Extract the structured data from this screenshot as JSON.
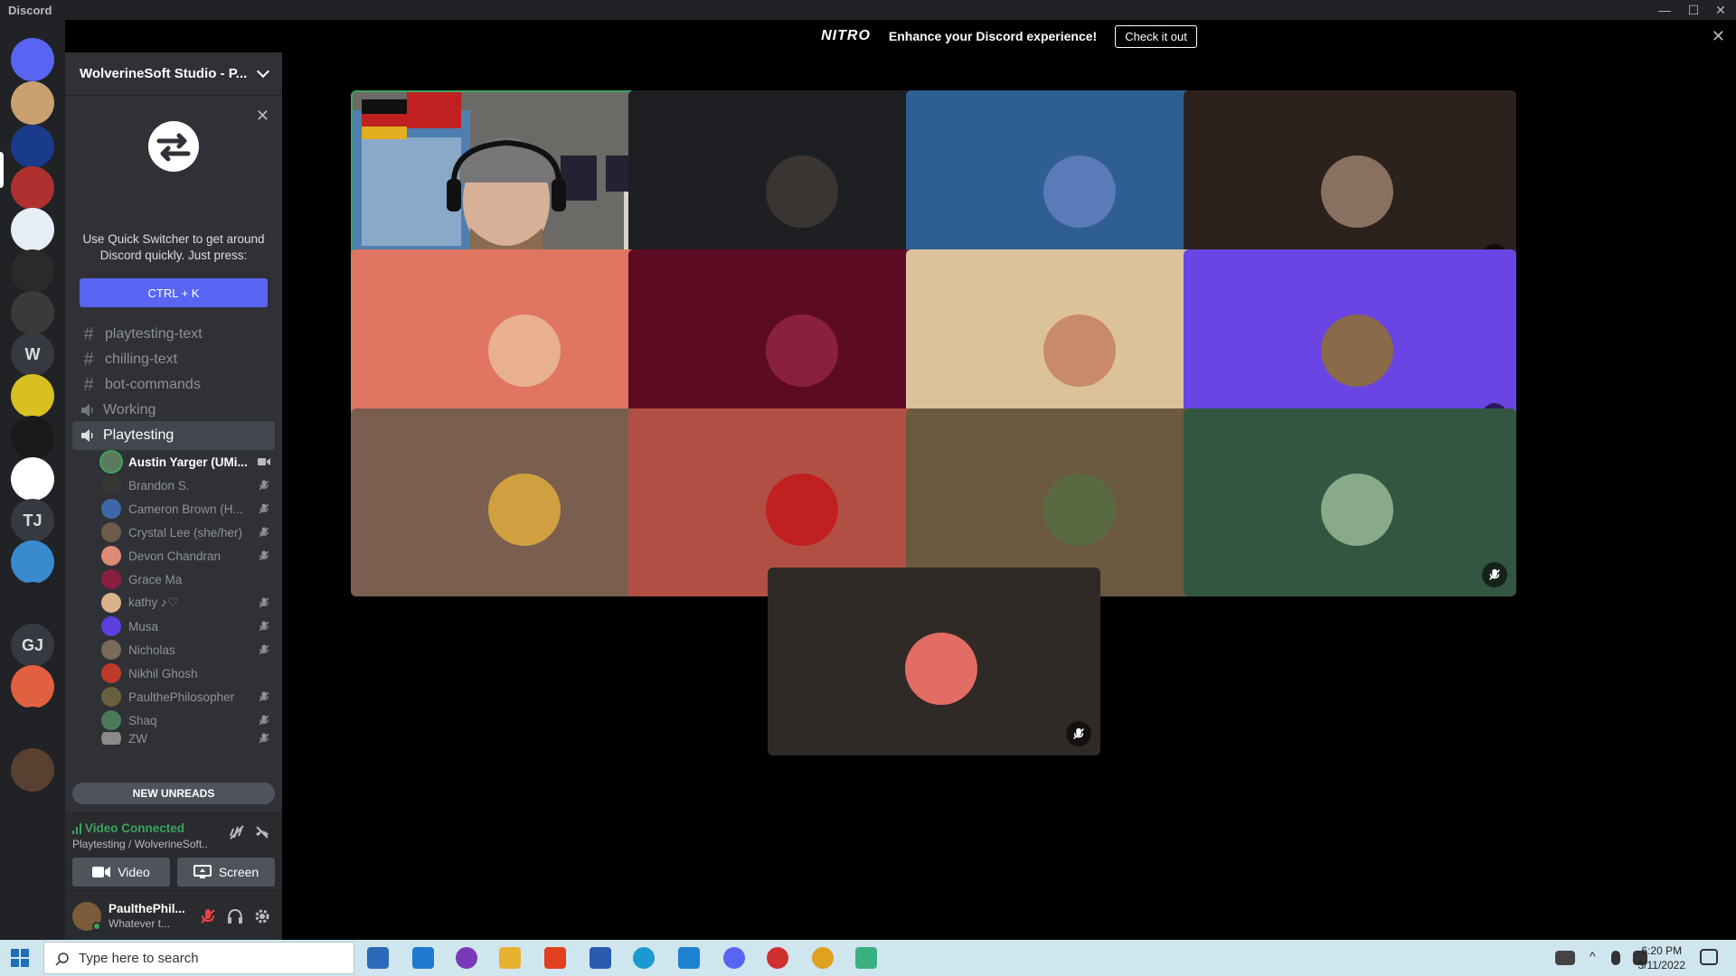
{
  "window": {
    "app_name": "Discord",
    "minimize": "—",
    "maximize": "☐",
    "close": "✕"
  },
  "nitro_banner": {
    "logo": "NITRO",
    "message": "Enhance your Discord experience!",
    "cta": "Check it out",
    "close": "✕"
  },
  "guild": {
    "name": "WolverineSoft Studio - P..."
  },
  "quick_switcher": {
    "text": "Use Quick Switcher to get around Discord quickly. Just press:",
    "shortcut": "CTRL + K",
    "close": "✕"
  },
  "channels": [
    {
      "name": "playtesting-text",
      "type": "text"
    },
    {
      "name": "chilling-text",
      "type": "text"
    },
    {
      "name": "bot-commands",
      "type": "text"
    },
    {
      "name": "Working",
      "type": "voice"
    },
    {
      "name": "Playtesting",
      "type": "voice",
      "active": true
    }
  ],
  "voice_members": [
    {
      "name": "Austin Yarger (UMi...",
      "color": "#5d7a5c",
      "muted": false,
      "video": true
    },
    {
      "name": "Brandon S.",
      "color": "#3a3535",
      "muted": true
    },
    {
      "name": "Cameron Brown (H...",
      "color": "#3f67a8",
      "muted": true
    },
    {
      "name": "Crystal Lee (she/her)",
      "color": "#6e5a4a",
      "muted": true
    },
    {
      "name": "Devon Chandran",
      "color": "#e08a78",
      "muted": true
    },
    {
      "name": "Grace Ma",
      "color": "#8a2040",
      "muted": false
    },
    {
      "name": "kathy ♪♡",
      "color": "#d9b48a",
      "muted": true
    },
    {
      "name": "Musa",
      "color": "#5f3ee0",
      "muted": true
    },
    {
      "name": "Nicholas",
      "color": "#7a6a5a",
      "muted": true
    },
    {
      "name": "Nikhil Ghosh",
      "color": "#c03a2a",
      "muted": false
    },
    {
      "name": "PaulthePhilosopher",
      "color": "#6a6040",
      "muted": true
    },
    {
      "name": "Shaq",
      "color": "#4a7a5a",
      "muted": true
    },
    {
      "name": "ZW",
      "color": "#8a8a8a",
      "muted": true
    }
  ],
  "new_unreads": "NEW UNREADS",
  "rtc": {
    "status": "Video Connected",
    "channel": "Playtesting / WolverineSoft...",
    "video_label": "Video",
    "screen_label": "Screen"
  },
  "user": {
    "name": "PaulthePhil...",
    "status": "Whatever t..."
  },
  "servers": [
    {
      "label": "",
      "color": "#5865f2"
    },
    {
      "label": "",
      "color": "#c9a070"
    },
    {
      "label": "",
      "color": "#1a3a8a"
    },
    {
      "label": "",
      "color": "#b03030"
    },
    {
      "label": "",
      "color": "#e8eef8"
    },
    {
      "label": "",
      "color": "#2a2a2a"
    },
    {
      "label": "",
      "color": "#3a3a3a"
    },
    {
      "label": "W",
      "color": "#36393f"
    },
    {
      "label": "",
      "color": "#d8c020"
    },
    {
      "label": "",
      "color": "#1a1a1a"
    },
    {
      "label": "",
      "color": "#ffffff"
    },
    {
      "label": "TJ",
      "color": "#36393f"
    },
    {
      "label": "",
      "color": "#3a8ad0"
    },
    {
      "label": "",
      "color": "#202225"
    },
    {
      "label": "GJ",
      "color": "#36393f"
    },
    {
      "label": "",
      "color": "#e06040"
    },
    {
      "label": "",
      "color": "#202225"
    },
    {
      "label": "",
      "color": "#5a4030"
    }
  ],
  "tiles": [
    {
      "name": "Austin Yarger",
      "bg": "#4a4a48",
      "avatar": "",
      "camera": true,
      "muted": false
    },
    {
      "name": "Brandon S.",
      "bg": "#1e1f22",
      "avatar": "#3a3533",
      "muted": true
    },
    {
      "name": "Cameron Brown",
      "bg": "#2f5e93",
      "avatar": "#5a7ab8",
      "muted": true
    },
    {
      "name": "Crystal Lee",
      "bg": "#2b211d",
      "avatar": "#8a7060",
      "muted": true
    },
    {
      "name": "Devon Chandran",
      "bg": "#e07562",
      "avatar": "#e8b090",
      "muted": true
    },
    {
      "name": "Grace Ma",
      "bg": "#5c0b23",
      "avatar": "#8a2040",
      "muted": false
    },
    {
      "name": "kathy",
      "bg": "#dcc29a",
      "avatar": "#c88a6a",
      "muted": true
    },
    {
      "name": "Musa",
      "bg": "#6a45e3",
      "avatar": "#8a6a4a",
      "muted": true
    },
    {
      "name": "Nicholas",
      "bg": "#7a5e50",
      "avatar": "#d0a040",
      "muted": true
    },
    {
      "name": "Nikhil Ghosh",
      "bg": "#b24f45",
      "avatar": "#c02020",
      "muted": false
    },
    {
      "name": "PaulthePhilosopher",
      "bg": "#6c5a40",
      "avatar": "#5a6a40",
      "muted": true
    },
    {
      "name": "Shaq",
      "bg": "#335642",
      "avatar": "#88aa88",
      "muted": true
    },
    {
      "name": "ZW",
      "bg": "#302a27",
      "avatar": "#e36c64",
      "muted": true
    }
  ],
  "taskbar": {
    "search_placeholder": "Type here to search",
    "time": "6:20 PM",
    "date": "3/11/2022"
  }
}
